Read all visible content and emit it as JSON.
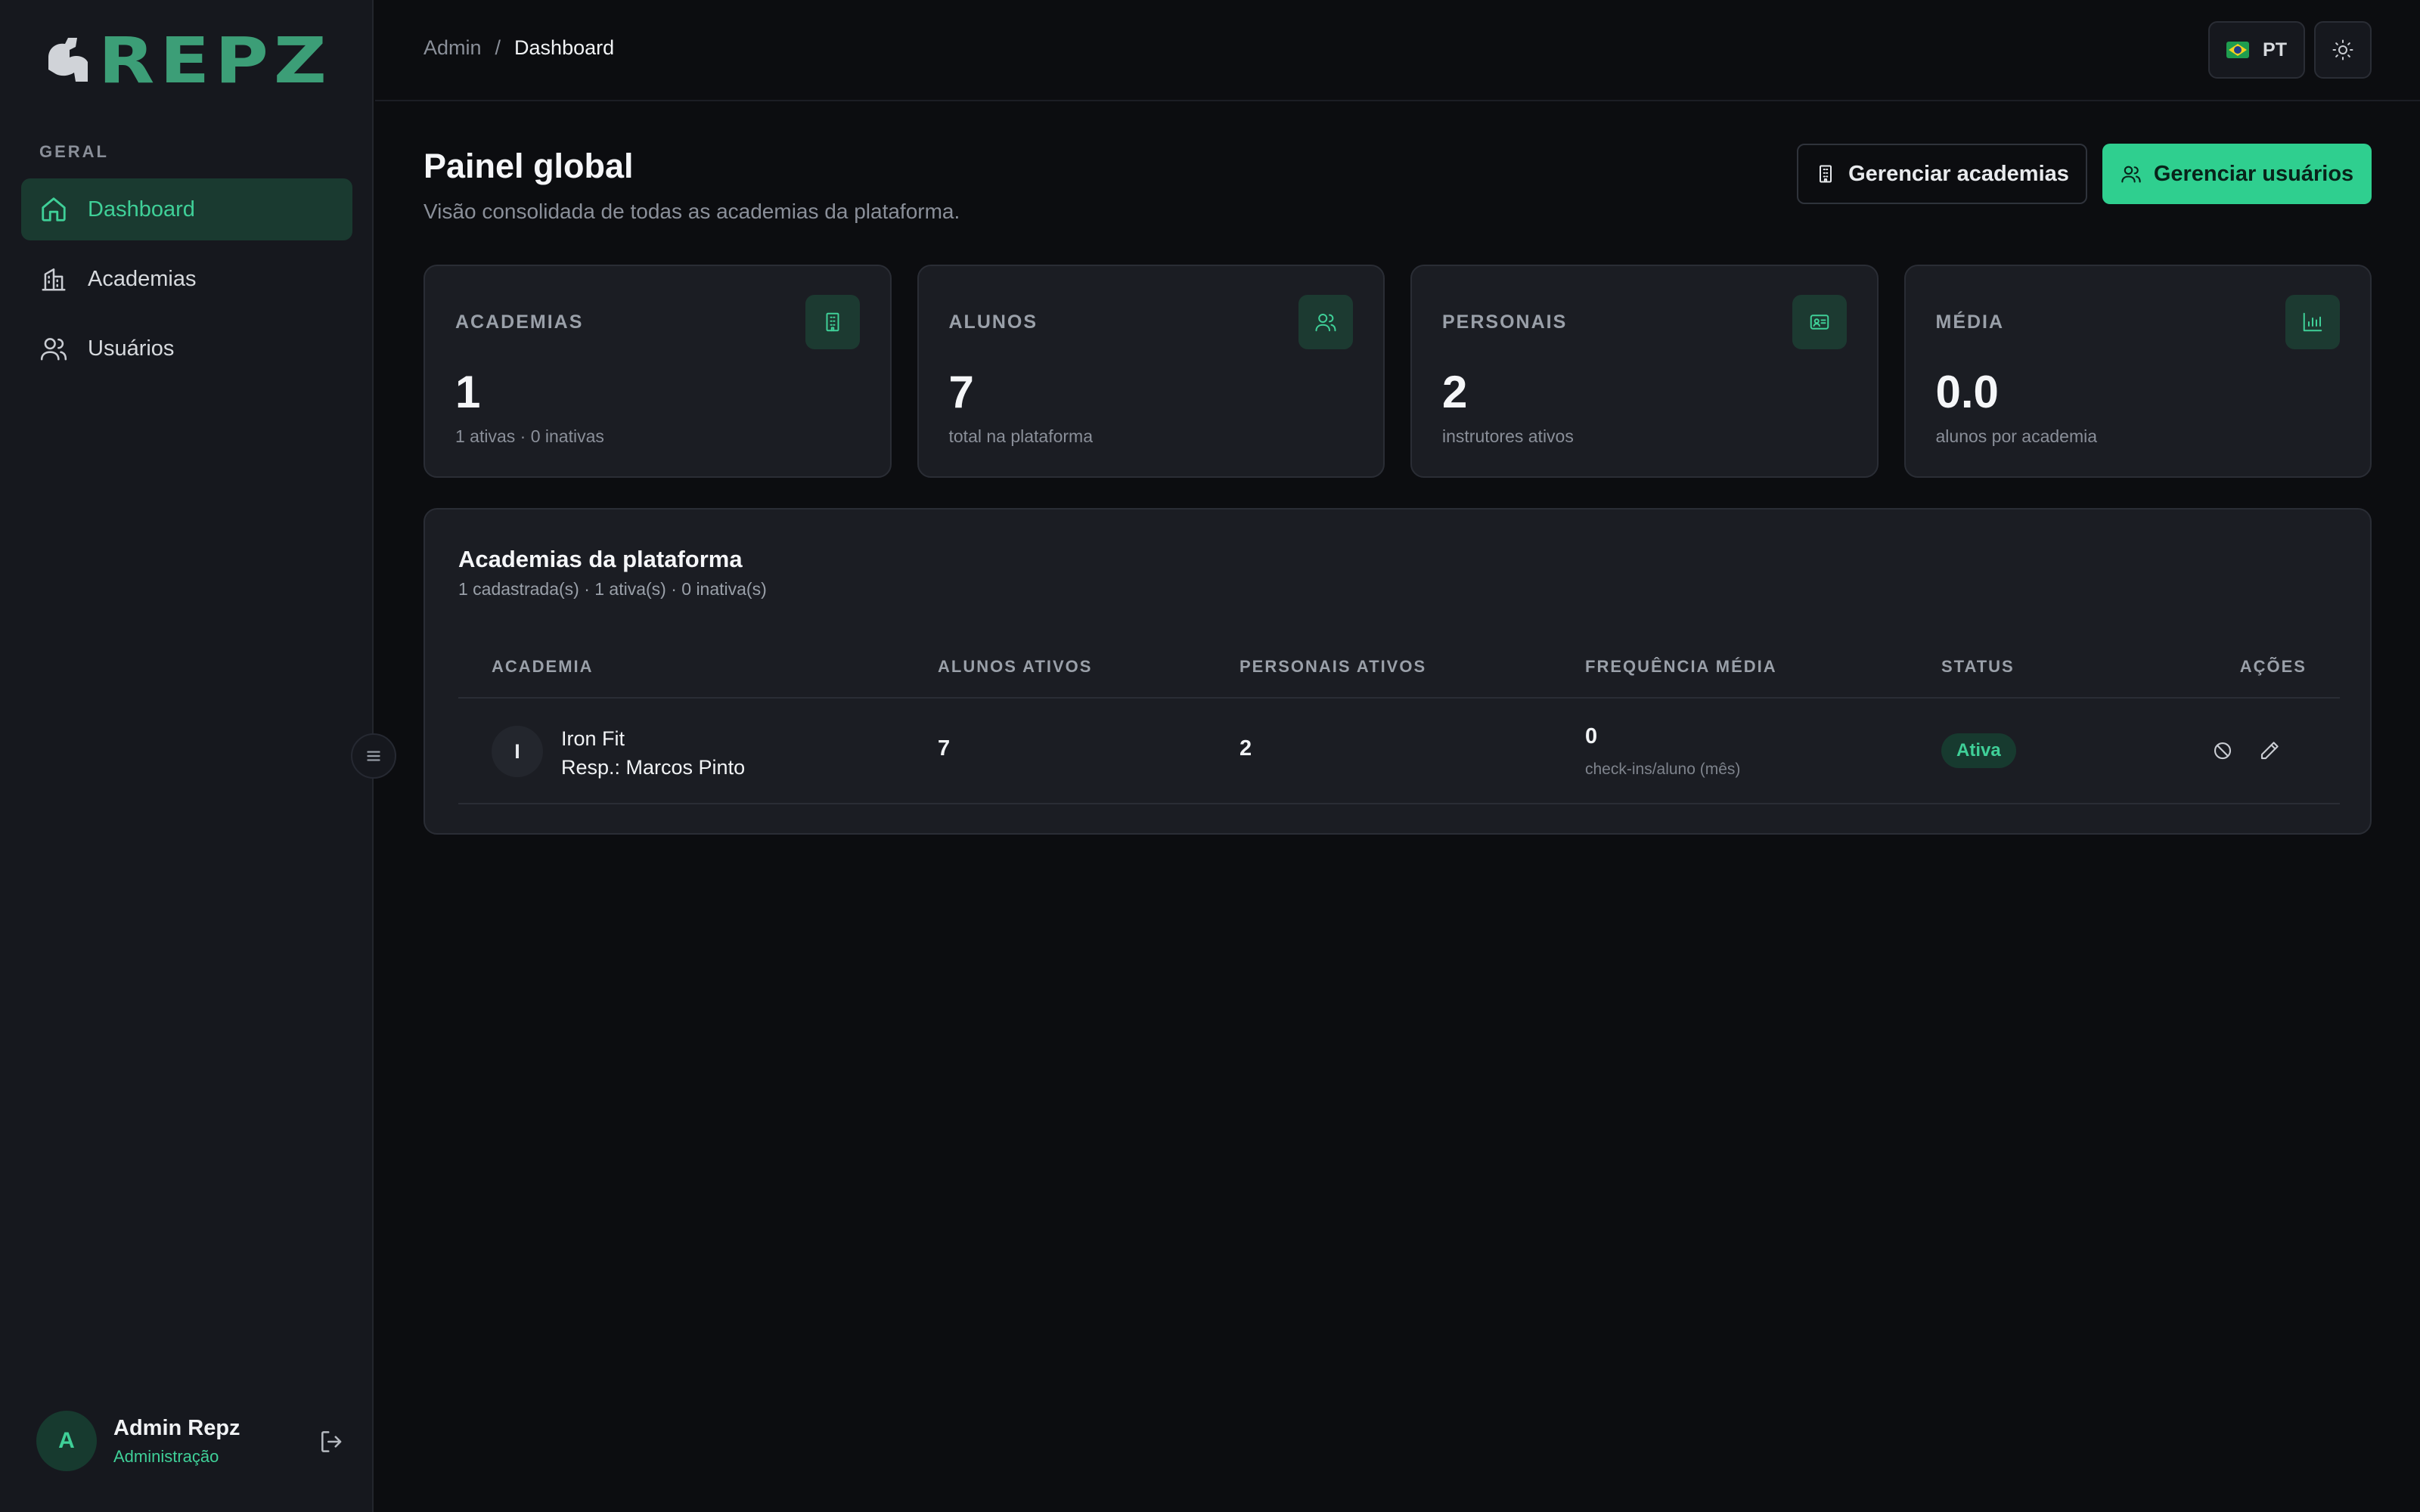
{
  "app": {
    "logo_text": "REPZ"
  },
  "sidebar": {
    "section_label": "GERAL",
    "items": [
      {
        "label": "Dashboard",
        "icon": "home-icon",
        "active": true
      },
      {
        "label": "Academias",
        "icon": "building-icon",
        "active": false
      },
      {
        "label": "Usuários",
        "icon": "users-icon",
        "active": false
      }
    ],
    "user": {
      "initial": "A",
      "name": "Admin Repz",
      "role": "Administração"
    }
  },
  "topbar": {
    "breadcrumb": {
      "root": "Admin",
      "separator": "/",
      "current": "Dashboard"
    },
    "language": "PT"
  },
  "header": {
    "title": "Painel global",
    "subtitle": "Visão consolidada de todas as academias da plataforma.",
    "manage_gyms_label": "Gerenciar academias",
    "manage_users_label": "Gerenciar usuários"
  },
  "stats": [
    {
      "label": "ACADEMIAS",
      "value": "1",
      "sub": "1 ativas · 0 inativas",
      "icon": "building-icon"
    },
    {
      "label": "ALUNOS",
      "value": "7",
      "sub": "total na plataforma",
      "icon": "users-icon"
    },
    {
      "label": "PERSONAIS",
      "value": "2",
      "sub": "instrutores ativos",
      "icon": "id-card-icon"
    },
    {
      "label": "MÉDIA",
      "value": "0.0",
      "sub": "alunos por academia",
      "icon": "bar-chart-icon"
    }
  ],
  "table": {
    "title": "Academias da plataforma",
    "subtitle": "1 cadastrada(s) · 1 ativa(s) · 0 inativa(s)",
    "columns": [
      "ACADEMIA",
      "ALUNOS ATIVOS",
      "PERSONAIS ATIVOS",
      "FREQUÊNCIA MÉDIA",
      "STATUS",
      "AÇÕES"
    ],
    "rows": [
      {
        "initial": "I",
        "name": "Iron Fit",
        "responsible": "Resp.: Marcos Pinto",
        "active_students": "7",
        "active_trainers": "2",
        "frequency": "0",
        "frequency_unit": "check-ins/aluno (mês)",
        "status": "Ativa"
      }
    ]
  },
  "colors": {
    "accent": "#2fcf8f",
    "background": "#0c0d10",
    "sidebar": "#16181e",
    "card": "#1b1d23"
  }
}
